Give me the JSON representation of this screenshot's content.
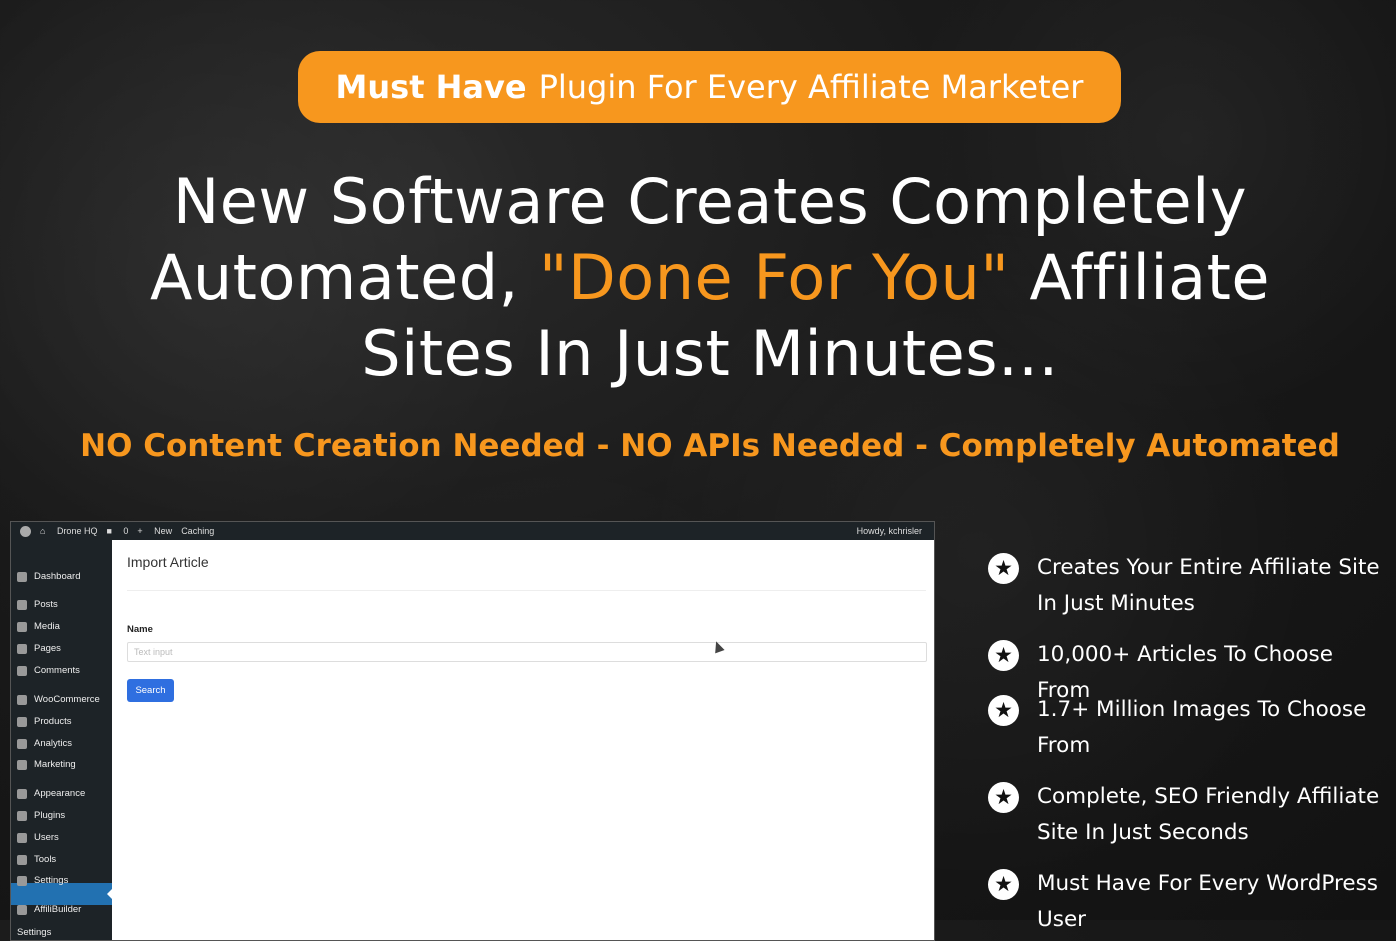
{
  "banner": {
    "bold": "Must Have",
    "rest": "Plugin For Every Affiliate Marketer"
  },
  "headline": {
    "line1": "New Software Creates Completely",
    "line2_pre": "Automated, ",
    "line2_highlight": "\"Done For You\"",
    "line2_post": " Affiliate",
    "line3": "Sites In Just Minutes..."
  },
  "subheadline": "NO Content Creation Needed - NO APIs Needed - Completely Automated",
  "colors": {
    "accent": "#f7971e",
    "background": "#1a1a1a",
    "wp_sidebar": "#1d2327",
    "wp_button": "#2f6fe0"
  },
  "screenshot": {
    "adminbar": {
      "site": "Drone HQ",
      "comments": "0",
      "new": "New",
      "caching": "Caching",
      "greeting": "Howdy, kchrisler"
    },
    "sidebar": [
      {
        "label": "Dashboard",
        "icon": "dashboard-icon"
      },
      {
        "label": "Posts",
        "icon": "pin-icon"
      },
      {
        "label": "Media",
        "icon": "media-icon"
      },
      {
        "label": "Pages",
        "icon": "pages-icon"
      },
      {
        "label": "Comments",
        "icon": "comment-icon"
      },
      {
        "label": "WooCommerce",
        "icon": "woocommerce-icon"
      },
      {
        "label": "Products",
        "icon": "products-icon"
      },
      {
        "label": "Analytics",
        "icon": "analytics-icon"
      },
      {
        "label": "Marketing",
        "icon": "marketing-icon"
      },
      {
        "label": "Appearance",
        "icon": "appearance-icon"
      },
      {
        "label": "Plugins",
        "icon": "plugins-icon"
      },
      {
        "label": "Users",
        "icon": "users-icon"
      },
      {
        "label": "Tools",
        "icon": "tools-icon"
      },
      {
        "label": "Settings",
        "icon": "settings-icon"
      },
      {
        "label": "AffiliBuilder",
        "icon": "affilibuilder-icon"
      },
      {
        "label": "Settings",
        "icon": ""
      }
    ],
    "page_title": "Import Article",
    "name_label": "Name",
    "input_placeholder": "Text input",
    "search_button": "Search"
  },
  "features": [
    "Creates Your Entire Affiliate Site In Just Minutes",
    "10,000+ Articles To Choose From",
    "1.7+ Million Images To Choose From",
    "Complete, SEO Friendly Affiliate Site In Just Seconds",
    "Must Have For Every WordPress User"
  ]
}
